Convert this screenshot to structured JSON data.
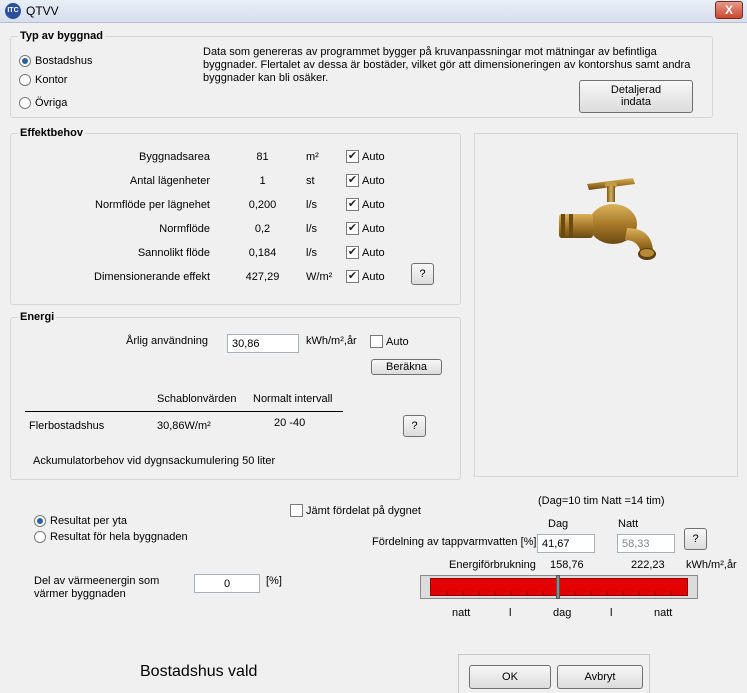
{
  "window": {
    "title": "QTVV",
    "app_icon": "app-logo-icon",
    "close_label": "X"
  },
  "building_type": {
    "title": "Typ av byggnad",
    "options": [
      "Bostadshus",
      "Kontor",
      "Övriga"
    ],
    "selected": "Bostadshus",
    "description": "Data som genereras av programmet bygger på kruvanpassningar mot mätningar av befintliga byggnader. Flertalet av dessa är bostäder, vilket gör att dimensioneringen av kontorshus samt andra byggnader kan bli osäker.",
    "detail_button_line1": "Detaljerad",
    "detail_button_line2": "indata"
  },
  "effect": {
    "title": "Effektbehov",
    "rows": [
      {
        "label": "Byggnadsarea",
        "value": "81",
        "unit": "m²",
        "auto": true
      },
      {
        "label": "Antal lägenheter",
        "value": "1",
        "unit": "st",
        "auto": true
      },
      {
        "label": "Normflöde per lägnehet",
        "value": "0,200",
        "unit": "l/s",
        "auto": true
      },
      {
        "label": "Normflöde",
        "value": "0,2",
        "unit": "l/s",
        "auto": true
      },
      {
        "label": "Sannolikt flöde",
        "value": "0,184",
        "unit": "l/s",
        "auto": true
      },
      {
        "label": "Dimensionerande effekt",
        "value": "427,29",
        "unit": "W/m²",
        "auto": true
      }
    ],
    "auto_label": "Auto",
    "help_label": "?"
  },
  "image": {
    "icon": "brass-faucet-icon"
  },
  "energy": {
    "title": "Energi",
    "annual_label": "Årlig användning",
    "annual_value": "30,86",
    "annual_unit": "kWh/m²,år",
    "auto_label": "Auto",
    "auto_checked": false,
    "calc_button": "Beräkna",
    "col_template": "Schablonvärden",
    "col_interval": "Normalt intervall",
    "row_label": "Flerbostadshus",
    "row_template": "30,86W/m²",
    "row_interval": "20 -40",
    "help_label": "?",
    "accumulator_text": "Ackumulatorbehov vid dygnsackumulering 50 liter"
  },
  "results": {
    "options": [
      "Resultat per yta",
      "Resultat för hela byggnaden"
    ],
    "selected": "Resultat per yta",
    "even_label": "Jämt fördelat på dygnet",
    "even_checked": false,
    "day_night_note": "(Dag=10 tim Natt =14 tim)",
    "day_header": "Dag",
    "night_header": "Natt",
    "distribution_label": "Fördelning av tappvarmvatten [%]",
    "day_value": "41,67",
    "night_value": "58,33",
    "help_label": "?",
    "consumption_label": "Energiförbrukning",
    "day_consumption": "158,76",
    "night_consumption": "222,23",
    "consumption_unit": "kWh/m²,år",
    "heat_label_line1": "Del av värmeenergin som",
    "heat_label_line2": "värmer byggnaden",
    "heat_value": "0",
    "heat_unit": "[%]",
    "bar_labels": [
      "natt",
      "l",
      "dag",
      "l",
      "natt"
    ],
    "bar_color": "#e30000"
  },
  "status": {
    "text": "Bostadshus vald"
  },
  "footer": {
    "ok_label": "OK",
    "cancel_label": "Avbryt"
  }
}
